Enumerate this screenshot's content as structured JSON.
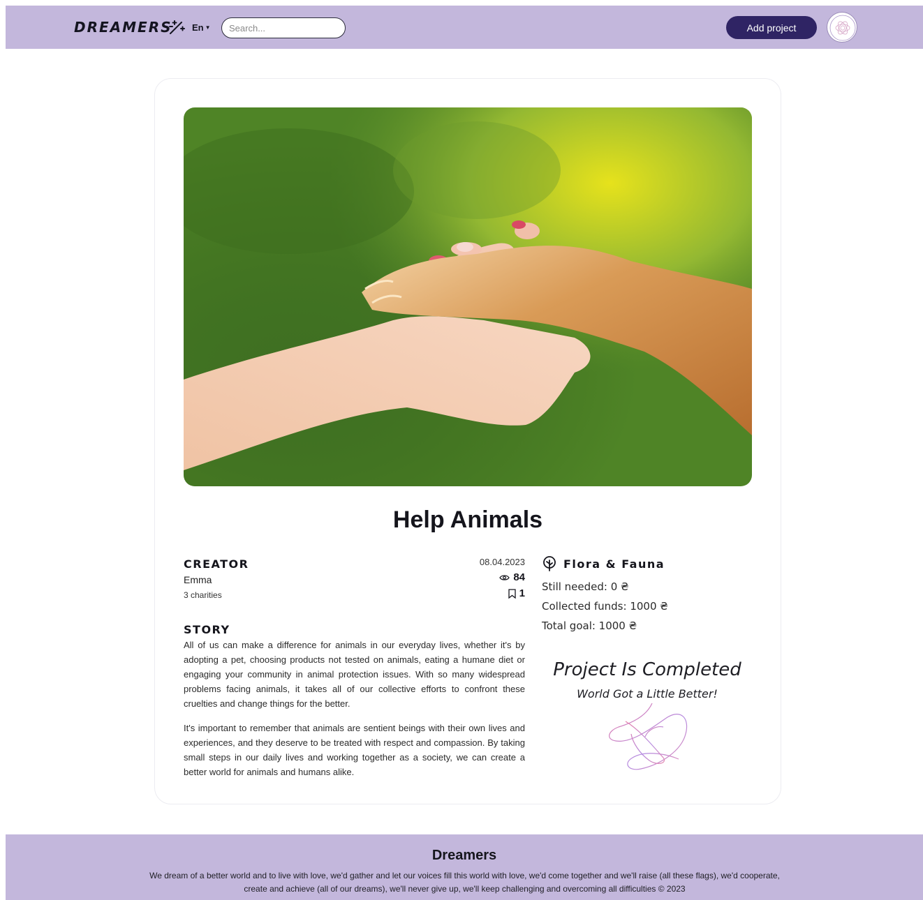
{
  "header": {
    "logo": "DREAMERS",
    "logo_icon": "magic-wand-sparkle-icon",
    "language": "En",
    "search_placeholder": "Search...",
    "add_project_label": "Add project",
    "avatar_icon": "user-avatar-icon"
  },
  "project": {
    "image_description_icon": "hero-photo",
    "title": "Help Animals",
    "creator_heading": "CREATOR",
    "creator_name": "Emma",
    "creator_charities": "3 charities",
    "date": "08.04.2023",
    "views": "84",
    "bookmarks": "1",
    "story_heading": "STORY",
    "story_paragraphs": [
      "All of us can make a difference for animals in our everyday lives, whether it's by adopting a pet, choosing products not tested on animals, eating a humane diet or engaging your community in animal protection issues. With so many widespread problems facing animals, it takes all of our collective efforts to confront these cruelties and change things for the better.",
      "It's important to remember that animals are sentient beings with their own lives and experiences, and they deserve to be treated with respect and compassion. By taking small steps in our daily lives and working together as a society, we can create a better world for animals and humans alike."
    ],
    "category": "Flora & Fauna",
    "still_needed": "Still needed: 0 ₴",
    "collected": "Collected funds: 1000 ₴",
    "goal": "Total goal: 1000 ₴",
    "completed_title": "Project Is Completed",
    "completed_subtitle": "World Got a Little Better!"
  },
  "footer": {
    "title": "Dreamers",
    "text": "We dream of a better world and to live with love, we'd gather and let our voices fill this world with love, we'd come together and we'll raise (all these flags), we'd cooperate, create and achieve (all of our dreams), we'll never give up, we'll keep challenging and overcoming all difficulties © 2023"
  },
  "colors": {
    "header_bg": "#c3b7dc",
    "button_bg": "#2f2464",
    "text": "#15151c"
  }
}
